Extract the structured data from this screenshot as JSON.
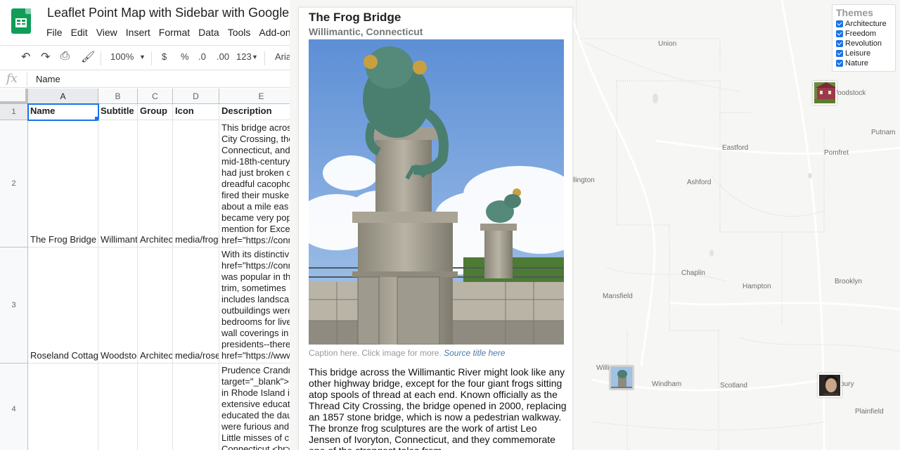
{
  "sheets": {
    "title": "Leaflet Point Map with Sidebar with Google Sheets",
    "menu": [
      "File",
      "Edit",
      "View",
      "Insert",
      "Format",
      "Data",
      "Tools",
      "Add-ons"
    ],
    "toolbar": {
      "zoom": "100%",
      "currency": "$",
      "percent": "%",
      "dec_less": ".0",
      "dec_more": ".00",
      "format": "123",
      "font": "Arial"
    },
    "formula_value": "Name",
    "columns": [
      "A",
      "B",
      "C",
      "D",
      "E"
    ],
    "rows": [
      "1",
      "2",
      "3",
      "4"
    ],
    "headers": [
      "Name",
      "Subtitle",
      "Group",
      "Icon",
      "Description"
    ],
    "row2": {
      "name": "The Frog Bridge",
      "subtitle": "Willimantic, Connecticut",
      "group": "Architecture",
      "icon": "media/frog",
      "desc": [
        "This bridge across the Willimantic River",
        "City Crossing, the bridge opened",
        "Connecticut, and",
        "mid-18th-century",
        "had just broken o",
        "dreadful cacopho",
        "fired their muske",
        "about a mile eas",
        "became very pop",
        "mention for Exce",
        "href=\"https://conn"
      ]
    },
    "row3": {
      "name": "Roseland Cottage",
      "subtitle": "Woodstock",
      "group": "Architecture",
      "icon": "media/rose",
      "desc": [
        "With its distinctiv",
        "href=\"https://conn",
        "was popular in th",
        "trim, sometimes",
        "includes landsca",
        "outbuildings were",
        "bedrooms for live",
        "wall coverings in",
        "presidents--there",
        "href=\"https://www"
      ]
    },
    "row4": {
      "desc": [
        "Prudence Crandry",
        "target=\"_blank\">",
        "in Rhode Island i",
        "extensive educat",
        "educated the dau",
        "were furious and",
        "Little misses of c",
        "Connecticut <br>"
      ]
    }
  },
  "map": {
    "towns": [
      "Union",
      "Woodstock",
      "Eastford",
      "Pomfret",
      "Putnam",
      "Ashford",
      "llington",
      "Chaplin",
      "Hampton",
      "Brooklyn",
      "Mansfield",
      "Willi",
      "Windham",
      "Scotland",
      "Canterbury",
      "Plainfield"
    ],
    "themes": {
      "title": "Themes",
      "items": [
        "Architecture",
        "Freedom",
        "Revolution",
        "Leisure",
        "Nature"
      ]
    }
  },
  "panel": {
    "title": "The Frog Bridge",
    "subtitle": "Willimantic, Connecticut",
    "caption": "Caption here. Click image for more.",
    "source": "Source title here",
    "description": "This bridge across the Willimantic River might look like any other highway bridge, except for the four giant frogs sitting atop spools of thread at each end. Known officially as the Thread City Crossing, the bridge opened in 2000, replacing an 1857 stone bridge, which is now a pedestrian walkway. The bronze frog sculptures are the work of artist Leo Jensen of Ivoryton, Connecticut, and they commemorate one of the strangest tales from"
  },
  "colors": {
    "sheets_green": "#0f9d58",
    "select_blue": "#1a73e8",
    "map_bg": "#f6f6f4",
    "link": "#4b7aa6"
  }
}
